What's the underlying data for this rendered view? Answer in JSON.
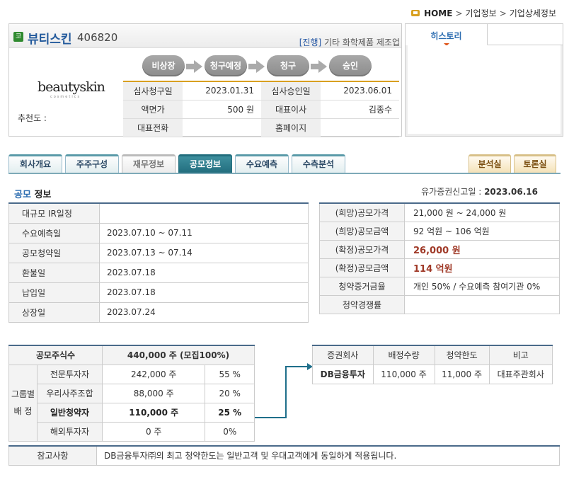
{
  "breadcrumb": {
    "home": "HOME",
    "level1": "기업정보",
    "level2": "기업상세정보"
  },
  "company": {
    "badge": "코",
    "name": "뷰티스킨",
    "code": "406820",
    "status_tag": "[진행]",
    "industry": "기타 화학제품 제조업",
    "logo_text": "beautyskin",
    "logo_sub": "cosmetics",
    "recommend_label": "추천도 :"
  },
  "steps": [
    "비상장",
    "청구예정",
    "청구",
    "승인"
  ],
  "company_info": [
    {
      "l1": "심사청구일",
      "v1": "2023.01.31",
      "l2": "심사승인일",
      "v2": "2023.06.01"
    },
    {
      "l1": "액면가",
      "v1": "500 원",
      "l2": "대표이사",
      "v2": "김종수"
    },
    {
      "l1": "대표전화",
      "v1": "",
      "l2": "홈페이지",
      "v2": ""
    }
  ],
  "history": {
    "tab_label": "히스토리"
  },
  "tabs": [
    {
      "label": "회사개요",
      "style": ""
    },
    {
      "label": "주주구성",
      "style": ""
    },
    {
      "label": "재무정보",
      "style": "gray"
    },
    {
      "label": "공모정보",
      "style": "active"
    },
    {
      "label": "수요예측",
      "style": ""
    },
    {
      "label": "수측분석",
      "style": ""
    }
  ],
  "tabs_right": [
    "분석실",
    "토론실"
  ],
  "section": {
    "title_hl": "공모",
    "title_rest": " 정보",
    "filing_label": "유가증권신고일 : ",
    "filing_date": "2023.06.16"
  },
  "schedule": [
    {
      "label": "대규모 IR일정",
      "value": ""
    },
    {
      "label": "수요예측일",
      "value": "2023.07.10 ~ 07.11"
    },
    {
      "label": "공모청약일",
      "value": "2023.07.13 ~ 07.14"
    },
    {
      "label": "환불일",
      "value": "2023.07.18"
    },
    {
      "label": "납입일",
      "value": "2023.07.18"
    },
    {
      "label": "상장일",
      "value": "2023.07.24"
    }
  ],
  "pricing": [
    {
      "label": "(희망)공모가격",
      "value": "21,000 원 ~ 24,000 원",
      "strong": false
    },
    {
      "label": "(희망)공모금액",
      "value": "92 억원  ~ 106 억원",
      "strong": false
    },
    {
      "label": "(확정)공모가격",
      "value": "26,000 원",
      "strong": true
    },
    {
      "label": "(확정)공모금액",
      "value": "114 억원",
      "strong": true
    },
    {
      "label": "청약증거금율",
      "value": "개인 50% / 수요예측 참여기관 0%",
      "strong": false
    },
    {
      "label": "청약경쟁률",
      "value": "",
      "strong": false
    }
  ],
  "shares": {
    "total_label": "공모주식수",
    "total_value": "440,000 주 (모집100%)",
    "group_label_1": "그룹별",
    "group_label_2": "배 정",
    "rows": [
      {
        "name": "전문투자자",
        "qty": "242,000 주",
        "pct": "55 %",
        "bold": false
      },
      {
        "name": "우리사주조합",
        "qty": "88,000 주",
        "pct": "20 %",
        "bold": false
      },
      {
        "name": "일반청약자",
        "qty": "110,000 주",
        "pct": "25 %",
        "bold": true
      },
      {
        "name": "해외투자자",
        "qty": "0 주",
        "pct": "0%",
        "bold": false
      }
    ]
  },
  "underwriters": {
    "headers": [
      "증권회사",
      "배정수량",
      "청약한도",
      "비고"
    ],
    "rows": [
      {
        "company": "DB금융투자",
        "qty": "110,000 주",
        "limit": "11,000 주",
        "note": "대표주관회사"
      }
    ]
  },
  "notes": {
    "label": "참고사항",
    "value": "DB금융투자㈜의 최고 청약한도는 일반고객 및 우대고객에게 동일하게 적용됩니다."
  }
}
